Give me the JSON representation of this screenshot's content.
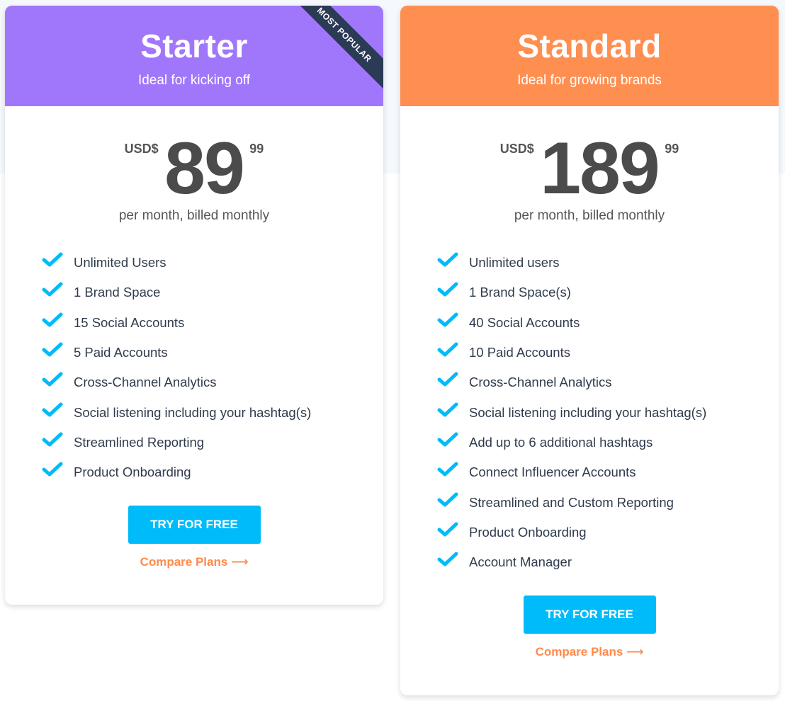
{
  "colors": {
    "starter_header": "#a077fb",
    "standard_header": "#ff8f51",
    "ribbon": "#2b3a55",
    "check": "#00bbf9",
    "cta": "#00bbf9",
    "link": "#ff8a4c"
  },
  "plans": [
    {
      "name": "Starter",
      "tagline": "Ideal for kicking off",
      "ribbon": "MOST POPULAR",
      "currency": "USD$",
      "amount": "89",
      "cents": "99",
      "billing": "per month, billed monthly",
      "features": [
        "Unlimited Users",
        "1 Brand Space",
        "15 Social Accounts",
        "5 Paid Accounts",
        "Cross-Channel Analytics",
        "Social listening including your hashtag(s)",
        "Streamlined Reporting",
        "Product Onboarding"
      ],
      "cta_label": "TRY FOR FREE",
      "compare_label": "Compare Plans",
      "compare_icon": "arrow-right-icon"
    },
    {
      "name": "Standard",
      "tagline": "Ideal for growing brands",
      "currency": "USD$",
      "amount": "189",
      "cents": "99",
      "billing": "per month, billed monthly",
      "features": [
        "Unlimited users",
        "1 Brand Space(s)",
        "40 Social Accounts",
        "10 Paid Accounts",
        "Cross-Channel Analytics",
        "Social listening including your hashtag(s)",
        "Add up to 6 additional hashtags",
        "Connect Influencer Accounts",
        "Streamlined and Custom Reporting",
        "Product Onboarding",
        "Account Manager"
      ],
      "cta_label": "TRY FOR FREE",
      "compare_label": "Compare Plans",
      "compare_icon": "arrow-right-icon"
    }
  ]
}
